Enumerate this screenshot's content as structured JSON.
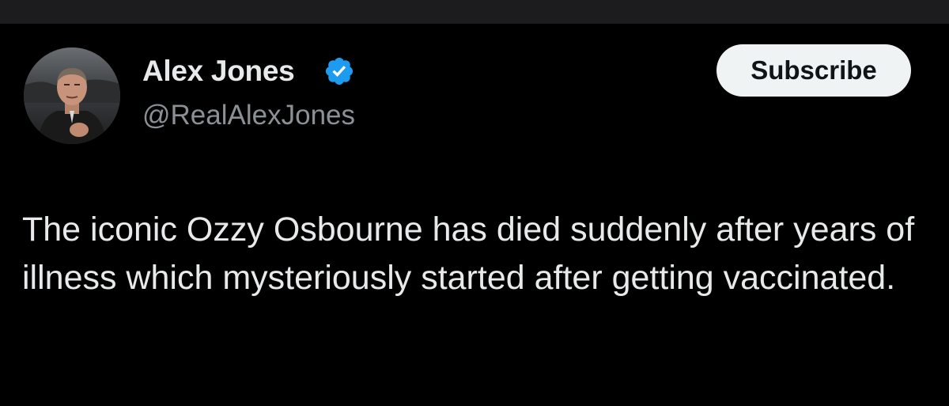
{
  "author": {
    "display_name": "Alex Jones",
    "handle": "@RealAlexJones",
    "verified_icon": "verified-badge-icon",
    "avatar": "profile-photo"
  },
  "actions": {
    "subscribe_label": "Subscribe"
  },
  "tweet": {
    "text": "The iconic Ozzy Osbourne has died suddenly after years of illness which mysteriously started after getting vaccinated."
  },
  "colors": {
    "background": "#000000",
    "top_bar": "#1c1c1e",
    "text_primary": "#e7e9ea",
    "text_secondary": "#8b9096",
    "verified": "#1d9bf0",
    "button_bg": "#eff3f4",
    "button_text": "#0f1419"
  }
}
